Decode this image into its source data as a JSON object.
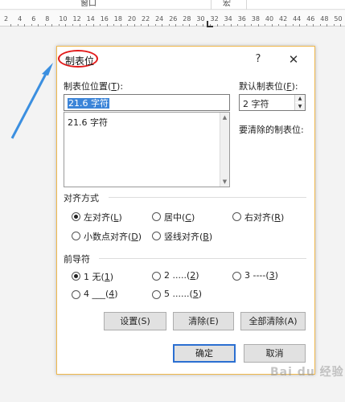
{
  "background": {
    "menu": {
      "window": "窗口",
      "macro": "宏"
    },
    "ruler_numbers": [
      "2",
      "4",
      "6",
      "8",
      "10",
      "12",
      "14",
      "16",
      "18",
      "20",
      "22",
      "24",
      "26",
      "28",
      "30",
      "32",
      "34",
      "36",
      "38",
      "40",
      "42",
      "44",
      "46",
      "48",
      "50"
    ]
  },
  "dialog": {
    "title": "制表位",
    "help": "?",
    "close": "✕",
    "tab_position_label_pre": "制表位位置(",
    "tab_position_label_key": "T",
    "tab_position_label_post": "):",
    "tab_position_value": "21.6 字符",
    "tab_list_items": [
      "21.6 字符"
    ],
    "default_tab_label_pre": "默认制表位(",
    "default_tab_label_key": "F",
    "default_tab_label_post": "):",
    "default_tab_value": "2 字符",
    "to_clear_label": "要清除的制表位:",
    "alignment": {
      "group_label": "对齐方式",
      "options": [
        {
          "pre": "左对齐(",
          "key": "L",
          "post": ")",
          "checked": true
        },
        {
          "pre": "居中(",
          "key": "C",
          "post": ")",
          "checked": false
        },
        {
          "pre": "右对齐(",
          "key": "R",
          "post": ")",
          "checked": false
        },
        {
          "pre": "小数点对齐(",
          "key": "D",
          "post": ")",
          "checked": false
        },
        {
          "pre": "竖线对齐(",
          "key": "B",
          "post": ")",
          "checked": false
        }
      ]
    },
    "leader": {
      "group_label": "前导符",
      "options": [
        {
          "pre": "1 无(",
          "key": "1",
          "post": ")",
          "checked": true
        },
        {
          "pre": "2 .....(",
          "key": "2",
          "post": ")",
          "checked": false
        },
        {
          "pre": "3 ----(",
          "key": "3",
          "post": ")",
          "checked": false
        },
        {
          "pre": "4 ___(",
          "key": "4",
          "post": ")",
          "checked": false
        },
        {
          "pre": "5 ......(",
          "key": "5",
          "post": ")",
          "checked": false
        }
      ]
    },
    "buttons": {
      "set": "设置(S)",
      "clear": "清除(E)",
      "clear_all": "全部清除(A)",
      "ok": "确定",
      "cancel": "取消"
    }
  },
  "watermark": "Bai du 经验",
  "colors": {
    "arrow": "#3b8fe0",
    "title_circle": "#e21c1c",
    "selection": "#3b84d8",
    "primary_border": "#2b6fd1"
  }
}
